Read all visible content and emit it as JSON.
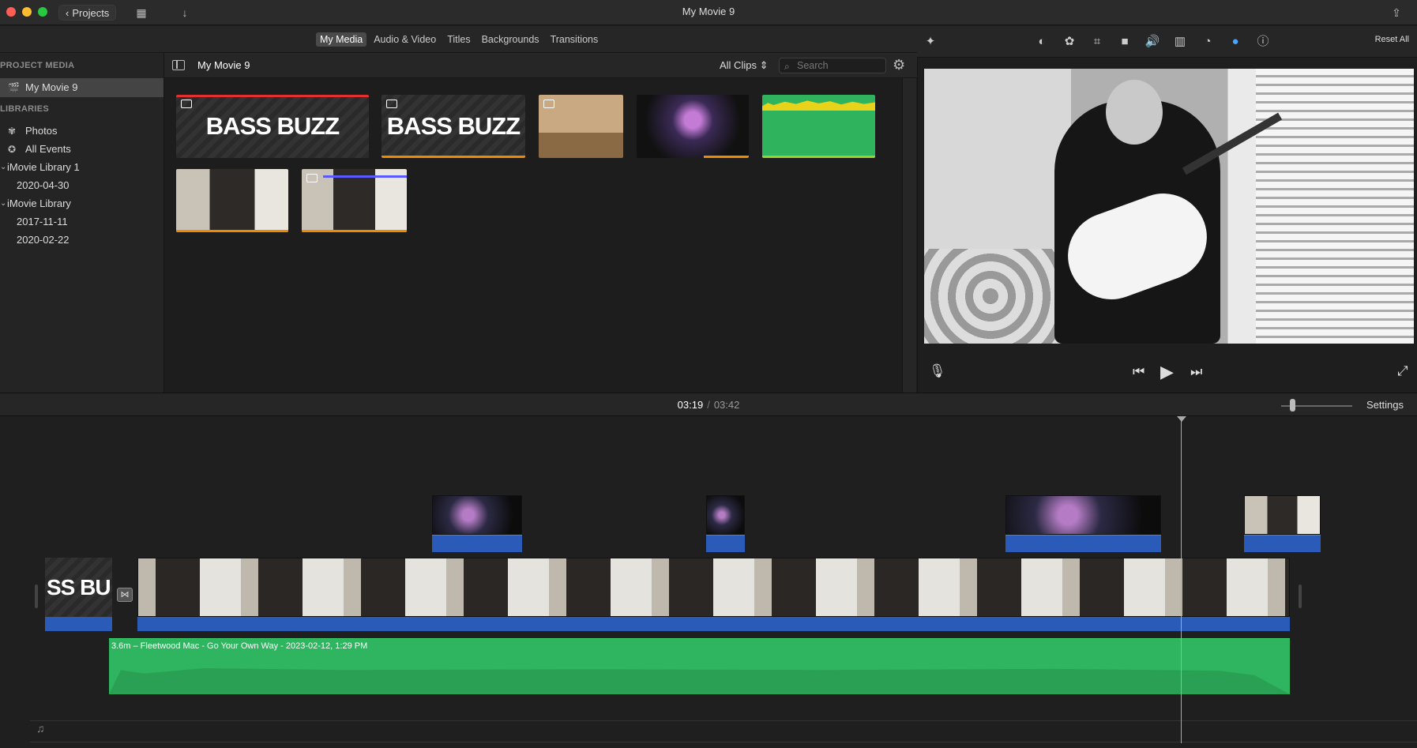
{
  "window": {
    "title": "My Movie 9",
    "projects_label": "Projects"
  },
  "browser_tabs": [
    "My Media",
    "Audio & Video",
    "Titles",
    "Backgrounds",
    "Transitions"
  ],
  "inspector": {
    "reset_all": "Reset All",
    "icons": [
      "magic-wand-icon",
      "color-balance-icon",
      "color-palette-icon",
      "crop-icon",
      "stabilization-icon",
      "volume-icon",
      "equalizer-icon",
      "speed-icon",
      "clip-filter-icon",
      "info-icon"
    ]
  },
  "sidebar": {
    "project_media_header": "PROJECT MEDIA",
    "project_item": "My Movie 9",
    "libraries_header": "LIBRARIES",
    "items": [
      {
        "label": "Photos"
      },
      {
        "label": "All Events"
      },
      {
        "label": "iMovie Library 1"
      },
      {
        "label": "2020-04-30"
      },
      {
        "label": "iMovie Library"
      },
      {
        "label": "2017-11-11"
      },
      {
        "label": "2020-02-22"
      }
    ]
  },
  "browser": {
    "title": "My Movie 9",
    "filter": "All Clips",
    "search_placeholder": "Search",
    "clip_text_1": "BASS BUZZ",
    "clip_text_2": "BASS BUZZ"
  },
  "timeline": {
    "current_time": "03:19",
    "separator": "/",
    "total_time": "03:42",
    "settings": "Settings",
    "audio_clip": "3.6m – Fleetwood Mac - Go Your Own Way - 2023-02-12, 1:29 PM",
    "title_clip_text": "SS BU"
  }
}
